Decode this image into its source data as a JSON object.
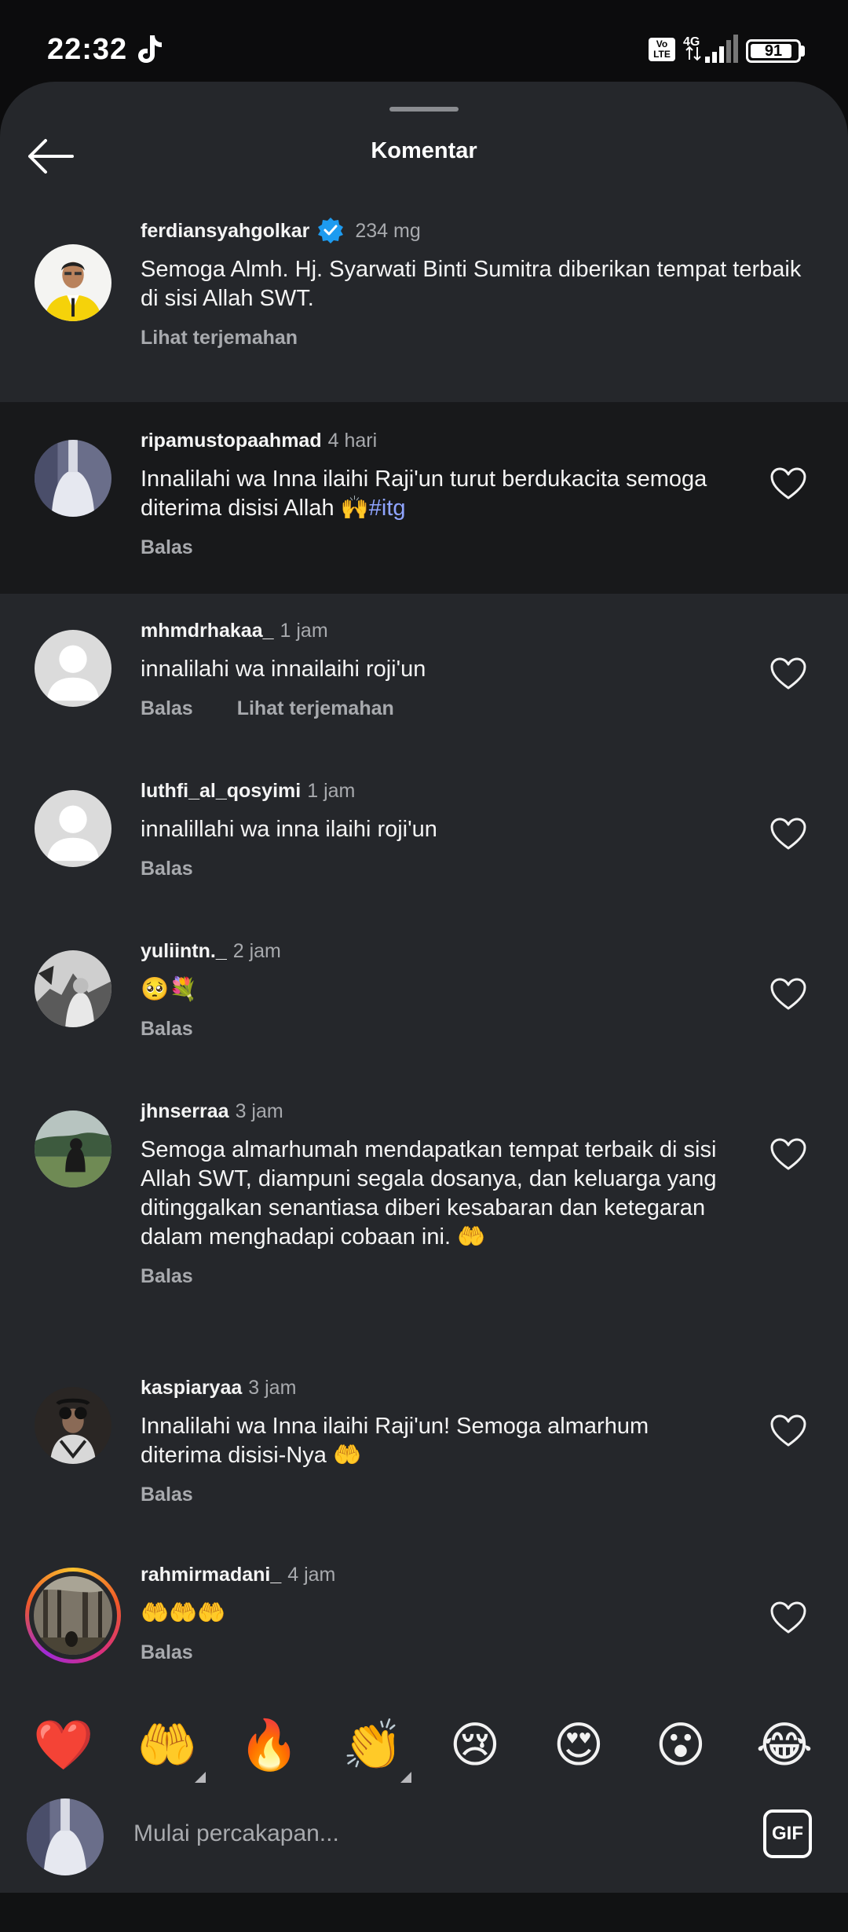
{
  "status_bar": {
    "time": "22:32",
    "network": "4G",
    "volte": "Vo\nLTE",
    "battery": "91",
    "battery_level": 0.91,
    "icons": [
      "tiktok-icon",
      "volte-icon",
      "signal-icon",
      "battery-icon"
    ]
  },
  "header": {
    "title": "Komentar",
    "back_icon": "arrow-left-icon"
  },
  "caption": {
    "username": "ferdiansyahgolkar",
    "verified": true,
    "time": "234 mg",
    "text": "Semoga Almh. Hj. Syarwati Binti Sumitra diberikan tempat terbaik di sisi Allah SWT.",
    "translate": "Lihat terjemahan"
  },
  "comments": [
    {
      "username": "ripamustopaahmad",
      "time": "4 hari",
      "text": "Innalilahi wa Inna ilaihi Raji'un turut berdukacita semoga diterima disisi Allah 🙌",
      "hashtag": "#itg",
      "reply": "Balas",
      "translate": ""
    },
    {
      "username": "mhmdrhakaa_",
      "time": "1 jam",
      "text": "innalilahi wa innailaihi roji'un",
      "reply": "Balas",
      "translate": "Lihat terjemahan"
    },
    {
      "username": "luthfi_al_qosyimi",
      "time": "1 jam",
      "text": "innalillahi wa inna ilaihi roji'un",
      "reply": "Balas",
      "translate": ""
    },
    {
      "username": "yuliintn._",
      "time": "2 jam",
      "text": "🥺💐",
      "reply": "Balas",
      "translate": ""
    },
    {
      "username": "jhnserraa",
      "time": "3 jam",
      "text": "Semoga almarhumah mendapatkan tempat terbaik di sisi Allah SWT, diampuni segala dosanya, dan keluarga yang ditinggalkan senantiasa diberi kesabaran dan ketegaran dalam menghadapi cobaan ini. 🤲",
      "reply": "Balas",
      "translate": ""
    },
    {
      "username": "kaspiaryaa",
      "time": "3 jam",
      "text": "Innalilahi wa Inna ilaihi Raji'un! Semoga almarhum diterima disisi-Nya 🤲",
      "reply": "Balas",
      "translate": ""
    },
    {
      "username": "rahmirmadani_",
      "time": "4 jam",
      "text": "🤲🤲🤲",
      "reply": "Balas",
      "translate": ""
    }
  ],
  "reactions": [
    "❤️",
    "🤲",
    "🔥",
    "👏",
    "😢",
    "😍",
    "😮",
    "😂"
  ],
  "composer": {
    "placeholder": "Mulai percakapan...",
    "gif_label": "GIF"
  },
  "colors": {
    "sheet_background": "#25272b",
    "highlight_background": "#18191b",
    "hashtag": "#8fa4ff",
    "verified": "#1d9bf0"
  }
}
